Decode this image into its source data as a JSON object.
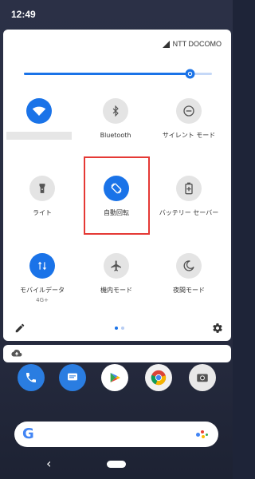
{
  "status_bar": {
    "time": "12:49"
  },
  "quick_settings": {
    "carrier": "NTT DOCOMO",
    "brightness_level": 0.88,
    "accent_color": "#1a73e8",
    "tiles": [
      {
        "label": "",
        "icon": "wifi-icon",
        "state": "on"
      },
      {
        "label": "Bluetooth",
        "icon": "bluetooth-icon",
        "state": "off"
      },
      {
        "label": "サイレント モード",
        "icon": "do-not-disturb-icon",
        "state": "off"
      },
      {
        "label": "ライト",
        "icon": "flashlight-icon",
        "state": "off"
      },
      {
        "label": "自動回転",
        "icon": "auto-rotate-icon",
        "state": "on"
      },
      {
        "label": "バッテリー セーバー",
        "icon": "battery-saver-icon",
        "state": "off"
      },
      {
        "label": "モバイルデータ",
        "sublabel": "4G+",
        "icon": "mobile-data-icon",
        "state": "on"
      },
      {
        "label": "機内モード",
        "icon": "airplane-icon",
        "state": "off"
      },
      {
        "label": "夜間モード",
        "icon": "night-mode-icon",
        "state": "off"
      }
    ],
    "page_count": 2,
    "current_page": 1,
    "highlight_color": "#e53935"
  }
}
